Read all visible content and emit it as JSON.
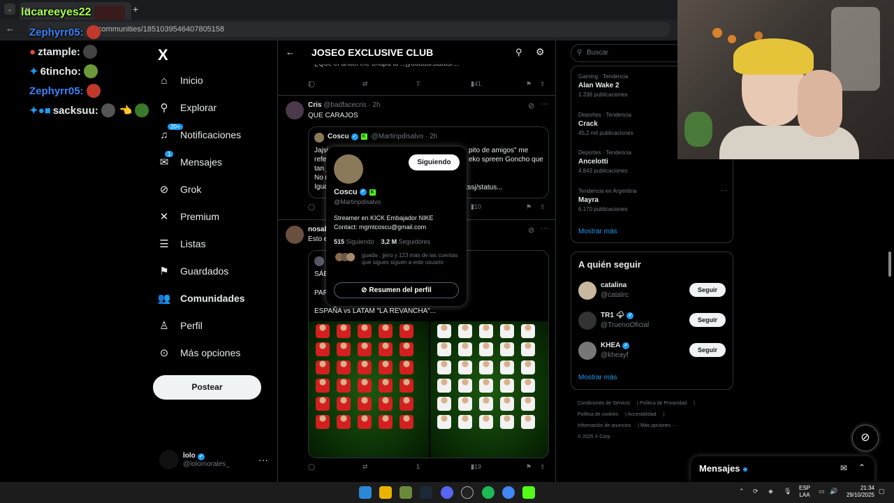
{
  "browser": {
    "tab_title": "lucareeyes22",
    "url": "communities/1851039546407805158",
    "new_tab": "+"
  },
  "chat": [
    {
      "user": "lucareeyes22",
      "color": "#a4ff4b"
    },
    {
      "user": "Zephyrr05:",
      "color": "#3b82f6"
    },
    {
      "user": "ztample:",
      "color": "#ffffff"
    },
    {
      "user": "6tincho:",
      "color": "#ffffff"
    },
    {
      "user": "Zephyrr05:",
      "color": "#3b82f6"
    },
    {
      "user": "sacksuu:",
      "color": "#ffffff"
    }
  ],
  "sidebar": {
    "logo": "X",
    "items": [
      {
        "label": "Inicio",
        "icon": "home-icon"
      },
      {
        "label": "Explorar",
        "icon": "search-icon"
      },
      {
        "label": "Notificaciones",
        "icon": "bell-icon",
        "badge": "20+"
      },
      {
        "label": "Mensajes",
        "icon": "mail-icon",
        "badge": "1"
      },
      {
        "label": "Grok",
        "icon": "grok-icon"
      },
      {
        "label": "Premium",
        "icon": "x-icon"
      },
      {
        "label": "Listas",
        "icon": "list-icon"
      },
      {
        "label": "Guardados",
        "icon": "bookmark-icon"
      },
      {
        "label": "Comunidades",
        "icon": "people-icon"
      },
      {
        "label": "Perfil",
        "icon": "person-icon"
      },
      {
        "label": "Más opciones",
        "icon": "more-icon"
      }
    ],
    "post_button": "Postear",
    "user": {
      "name": "lolo",
      "handle": "@lolomorales_"
    }
  },
  "main": {
    "title": "JOSEO EXCLUSIVE CLUB",
    "prev_post_text": "¿Qué el anuel me chapa la ...jyuuuuu/status/...",
    "prev_actions": {
      "replies": "1",
      "likes": "7",
      "views": "241"
    },
    "post1": {
      "name": "Cris",
      "handle": "@badfacecris · 2h",
      "text": "QUE CARAJOS",
      "quote": {
        "name": "Coscu",
        "handle": "@Martinpdisalvo · 2h",
        "lines": [
          "Jajsj",
          "refe",
          "tan j",
          "No r",
          "Igua"
        ],
        "right_lines": [
          "pito de amigos\" me",
          "eko spreen Goncho que",
          "",
          "",
          "yukssj/status..."
        ]
      },
      "views": "710"
    },
    "post2": {
      "name": "nosab",
      "text": "Esto e",
      "quote_lines": [
        "SÁB",
        "",
        "PAR",
        "",
        "ESPAÑA vs LATAM \"LA REVANCHA\"..."
      ],
      "likes": "1",
      "views": "319"
    }
  },
  "hovercard": {
    "name": "Coscu",
    "handle": "@Martinpdisalvo",
    "follow_label": "Siguiendo",
    "bio": [
      "Streamer en KICK Embajador NIKE",
      "Contact: mgmtcoscu@gmail.com"
    ],
    "following_count": "515",
    "following_label": "Siguiendo",
    "followers_count": "3,2 M",
    "followers_label": "Seguidores",
    "mutual": "guada·, jjero y 123 más de las cuentas que sigues siguen a este usuario",
    "summary_button": "Resumen del perfil"
  },
  "right": {
    "search_placeholder": "Buscar",
    "trends": [
      {
        "category": "Gaming · Tendencia",
        "title": "Alan Wake 2",
        "posts": "1.336 publicaciones"
      },
      {
        "category": "Deportes · Tendencia",
        "title": "Crack",
        "posts": "45,2 mil publicaciones"
      },
      {
        "category": "Deportes · Tendencia",
        "title": "Ancelotti",
        "posts": "4.843 publicaciones"
      },
      {
        "category": "Tendencia en Argentina",
        "title": "Mayra",
        "posts": "6.170 publicaciones"
      }
    ],
    "show_more": "Mostrar más",
    "who_to_follow_title": "A quién seguir",
    "who_to_follow": [
      {
        "name": "catalina",
        "handle": "@cataIrc",
        "button": "Seguir"
      },
      {
        "name": "TR1 🌩",
        "handle": "@TruenoOficial",
        "button": "Seguir"
      },
      {
        "name": "KHEA",
        "handle": "@kheayf",
        "button": "Seguir"
      }
    ],
    "show_more_2": "Mostrar más",
    "footer": [
      "Condiciones de Servicio",
      "Política de Privacidad",
      "Política de cookies",
      "Accesibilidad",
      "Información de anuncios",
      "Más opciones ···",
      "© 2025 X Corp."
    ]
  },
  "messages_drawer": {
    "title": "Mensajes"
  },
  "taskbar": {
    "lang": "ESP",
    "lang2": "LAA",
    "time": "21:34",
    "date": "29/10/2025"
  }
}
